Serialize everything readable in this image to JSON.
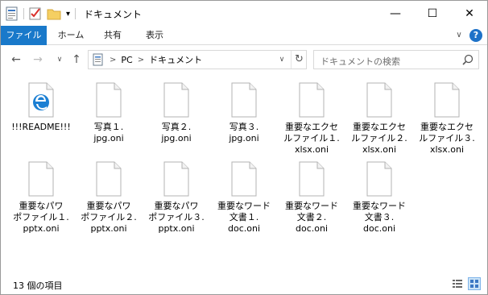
{
  "window": {
    "title": "ドキュメント",
    "controls": {
      "minimize": "—",
      "maximize": "☐",
      "close": "✕"
    }
  },
  "quick_access": {
    "dropdown": "▾"
  },
  "ribbon": {
    "tabs": [
      {
        "label": "ファイル",
        "active": true
      },
      {
        "label": "ホーム"
      },
      {
        "label": "共有"
      },
      {
        "label": "表示"
      }
    ],
    "expand_glyph": "∨",
    "help_glyph": "?"
  },
  "nav": {
    "back": "←",
    "forward": "→",
    "recent": "∨",
    "up": "↑",
    "breadcrumb": [
      "PC",
      "ドキュメント"
    ],
    "separator": ">",
    "dropdown": "∨",
    "refresh": "↻"
  },
  "search": {
    "placeholder": "ドキュメントの検索"
  },
  "files": [
    {
      "label": "!!!README!!!",
      "type": "edge"
    },
    {
      "label": "写真１.\njpg.oni",
      "type": "doc"
    },
    {
      "label": "写真２.\njpg.oni",
      "type": "doc"
    },
    {
      "label": "写真３.\njpg.oni",
      "type": "doc"
    },
    {
      "label": "重要なエクセ\nルファイル１.\nxlsx.oni",
      "type": "doc"
    },
    {
      "label": "重要なエクセ\nルファイル２.\nxlsx.oni",
      "type": "doc"
    },
    {
      "label": "重要なエクセ\nルファイル３.\nxlsx.oni",
      "type": "doc"
    },
    {
      "label": "重要なパワ\nポファイル１.\npptx.oni",
      "type": "doc"
    },
    {
      "label": "重要なパワ\nポファイル２.\npptx.oni",
      "type": "doc"
    },
    {
      "label": "重要なパワ\nポファイル３.\npptx.oni",
      "type": "doc"
    },
    {
      "label": "重要なワード\n文書１.\ndoc.oni",
      "type": "doc"
    },
    {
      "label": "重要なワード\n文書２.\ndoc.oni",
      "type": "doc"
    },
    {
      "label": "重要なワード\n文書３.\ndoc.oni",
      "type": "doc"
    }
  ],
  "status": {
    "item_count": "13 個の項目"
  },
  "colors": {
    "accent": "#1979ca",
    "selection": "#cce4f7"
  }
}
